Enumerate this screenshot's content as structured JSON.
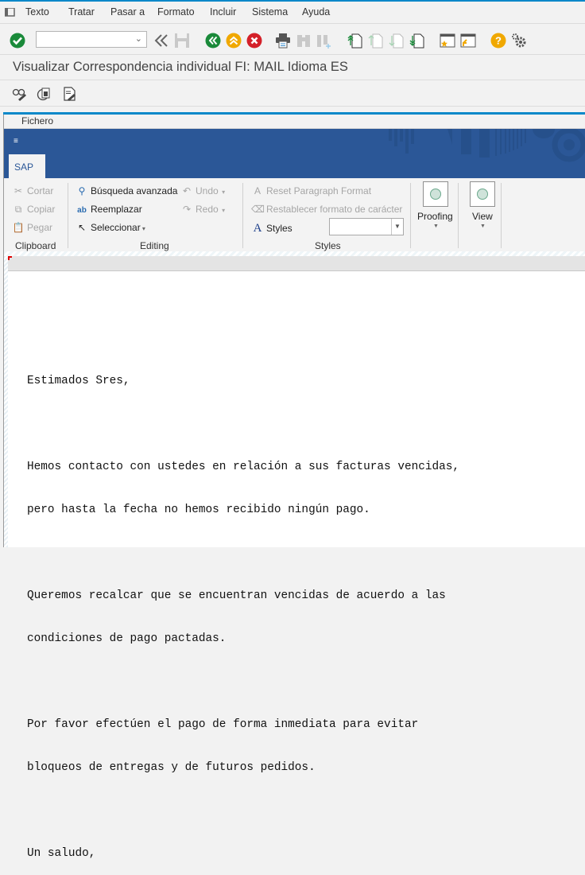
{
  "menubar": {
    "items": [
      "Texto",
      "Tratar",
      "Pasar a",
      "Formato",
      "Incluir",
      "Sistema",
      "Ayuda"
    ]
  },
  "toolbar": {
    "command_field": {
      "value": "",
      "placeholder": ""
    },
    "icons": [
      "enter-icon",
      "back-nav-icon",
      "save-icon",
      "back-icon",
      "exit-icon",
      "cancel-icon",
      "print-icon",
      "find-icon",
      "find-next-icon",
      "first-page-icon",
      "previous-page-icon",
      "next-page-icon",
      "last-page-icon",
      "new-session-icon",
      "shortcut-icon",
      "help-icon",
      "settings-icon"
    ]
  },
  "page": {
    "title": "Visualizar Correspondencia individual FI: MAIL Idioma ES"
  },
  "editor": {
    "file_menu": "Fichero",
    "tab": "SAP",
    "ribbon": {
      "clipboard": {
        "label": "Clipboard",
        "cut": "Cortar",
        "copy": "Copiar",
        "paste": "Pegar"
      },
      "editing": {
        "label": "Editing",
        "find": "Búsqueda avanzada",
        "replace": "Reemplazar",
        "select": "Seleccionar",
        "undo": "Undo",
        "redo": "Redo"
      },
      "styles": {
        "label": "Styles",
        "reset_paragraph": "Reset Paragraph Format",
        "reset_char": "Restablecer formato de carácter",
        "styles": "Styles",
        "style_value": ""
      },
      "proofing": "Proofing",
      "view": "View"
    },
    "document_lines": [
      "Estimados Sres,",
      "",
      "Hemos contacto con ustedes en relación a sus facturas vencidas,",
      "pero hasta la fecha no hemos recibido ningún pago.",
      "",
      "Queremos recalcar que se encuentran vencidas de acuerdo a las",
      "condiciones de pago pactadas.",
      "",
      "Por favor efectúen el pago de forma inmediata para evitar",
      "bloqueos de entregas y de futuros pedidos.",
      "",
      "Un saludo,"
    ]
  }
}
